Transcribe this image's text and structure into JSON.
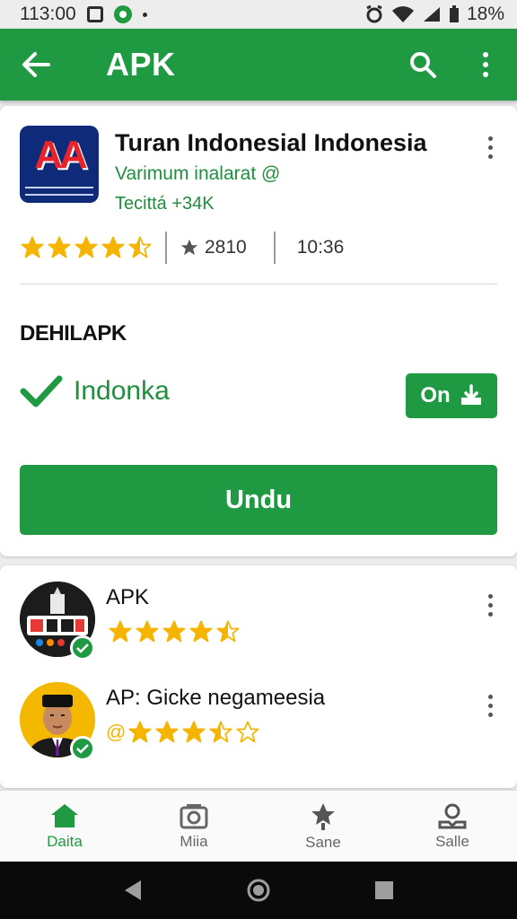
{
  "status_bar": {
    "time": "113:00",
    "battery": "18%"
  },
  "app_bar": {
    "title": "APK"
  },
  "app": {
    "icon_text": "AA",
    "name": "Turan Indonesial Indonesia",
    "developer": "Varimum inalarat @",
    "meta": "Tecittá +34K",
    "rating_stars": 4.5,
    "rating_count": "2810",
    "size": "10:36"
  },
  "section": {
    "title": "DEHILAPK",
    "status_label": "Indonka",
    "on_button_label": "On",
    "primary_button_label": "Undu"
  },
  "list": [
    {
      "title": "APK",
      "stars": 4.5,
      "prefix": ""
    },
    {
      "title": "AP: Gicke negameesia",
      "stars": 3.5,
      "prefix": "@"
    }
  ],
  "bottom_nav": [
    {
      "label": "Daita",
      "icon": "home-icon",
      "active": true
    },
    {
      "label": "Miia",
      "icon": "media-icon",
      "active": false
    },
    {
      "label": "Sane",
      "icon": "star-pin-icon",
      "active": false
    },
    {
      "label": "Salle",
      "icon": "account-icon",
      "active": false
    }
  ],
  "colors": {
    "primary": "#1f9a43",
    "star": "#f5b400",
    "text_green": "#1f8f3e"
  }
}
